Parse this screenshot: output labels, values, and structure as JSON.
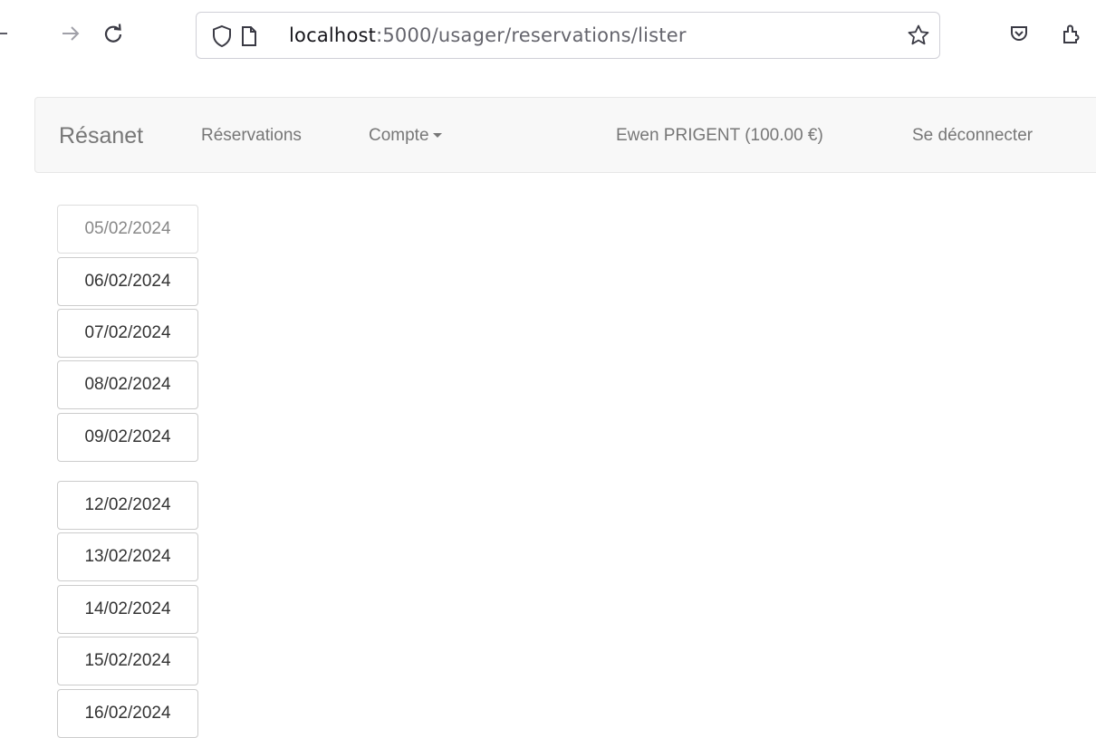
{
  "browser": {
    "url_host": "localhost",
    "url_rest": ":5000/usager/reservations/lister",
    "back_icon": "arrow-left-icon",
    "forward_icon": "arrow-right-icon",
    "reload_icon": "reload-icon",
    "shield_icon": "shield-icon",
    "page_icon": "page-icon",
    "bookmark_icon": "star-icon",
    "pocket_icon": "pocket-icon",
    "extensions_icon": "extensions-icon"
  },
  "navbar": {
    "brand": "Résanet",
    "reservations": "Réservations",
    "account": "Compte",
    "user": "Ewen PRIGENT (100.00 €)",
    "logout": "Se déconnecter"
  },
  "dates": [
    {
      "label": "05/02/2024",
      "state": "past"
    },
    {
      "label": "06/02/2024",
      "state": "open"
    },
    {
      "label": "07/02/2024",
      "state": "open"
    },
    {
      "label": "08/02/2024",
      "state": "open"
    },
    {
      "label": "09/02/2024",
      "state": "open"
    },
    {
      "label": "12/02/2024",
      "state": "open"
    },
    {
      "label": "13/02/2024",
      "state": "open"
    },
    {
      "label": "14/02/2024",
      "state": "open"
    },
    {
      "label": "15/02/2024",
      "state": "open"
    },
    {
      "label": "16/02/2024",
      "state": "open"
    }
  ]
}
